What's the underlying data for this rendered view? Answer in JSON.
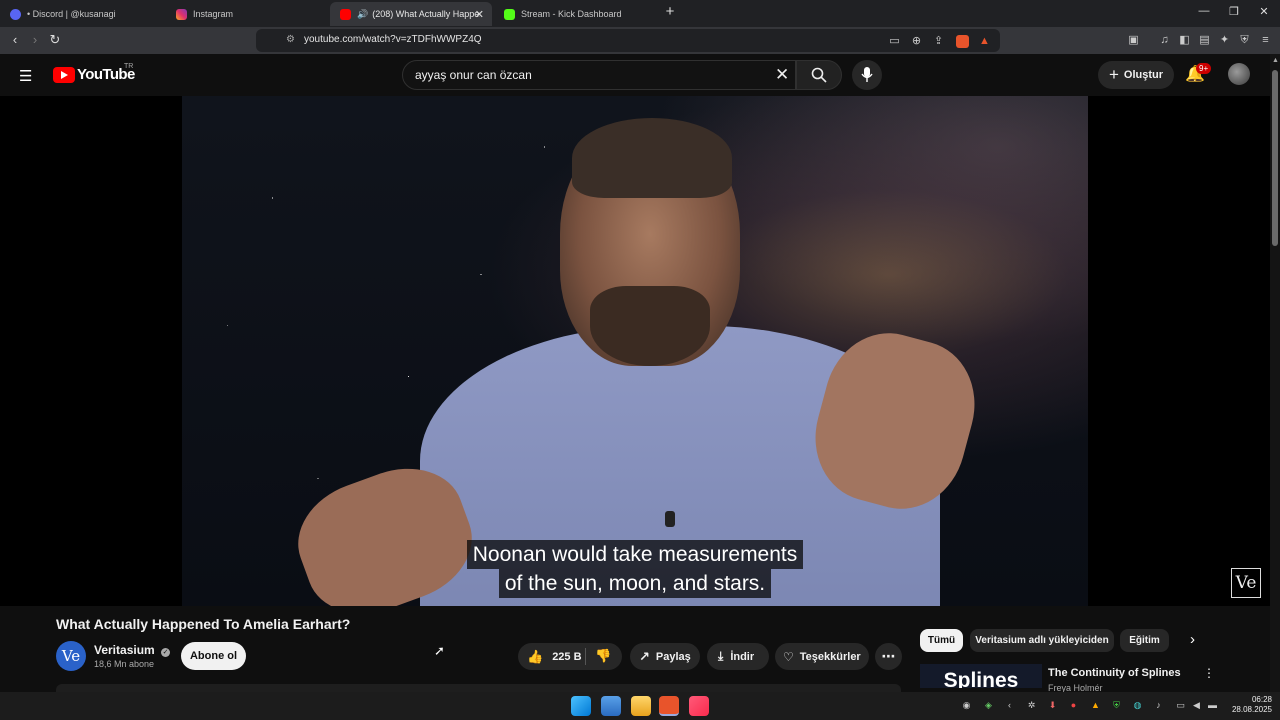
{
  "browser": {
    "tabs": [
      {
        "label": "• Discord | @kusanagi",
        "active": false
      },
      {
        "label": "Instagram",
        "active": false
      },
      {
        "label": "(208) What Actually Happene",
        "active": true
      },
      {
        "label": "Stream - Kick Dashboard",
        "active": false
      }
    ],
    "new_tab": "+",
    "url": "youtube.com/watch?v=zTDFhWWPZ4Q"
  },
  "youtube": {
    "logo_text": "YouTube",
    "logo_region": "TR",
    "search_value": "ayyaş onur can özcan",
    "create_label": "Oluştur",
    "notification_count": "9+"
  },
  "video": {
    "caption_line1": "Noonan would take measurements",
    "caption_line2": "of the sun, moon, and stars.",
    "watermark": "Ve",
    "title": "What Actually Happened To Amelia Earhart?"
  },
  "channel": {
    "avatar_text": "Ve",
    "name": "Veritasium",
    "subscribers": "18,6 Mn abone",
    "subscribe_label": "Abone ol"
  },
  "actions": {
    "likes": "225 B",
    "share": "Paylaş",
    "download": "İndir",
    "thanks": "Teşekkürler"
  },
  "chips": [
    "Tümü",
    "Veritasium adlı yükleyiciden",
    "Eğitim"
  ],
  "recommendation": {
    "thumb_text": "Splines",
    "title": "The Continuity of Splines",
    "channel": "Freya Holmér"
  },
  "taskbar": {
    "time": "06:28",
    "date": "28.08.2025"
  }
}
